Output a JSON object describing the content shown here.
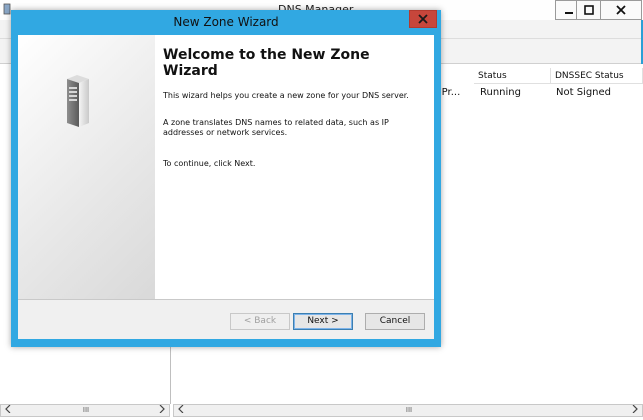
{
  "background_window": {
    "title": "DNS Manager",
    "columns": [
      "Status",
      "DNSSEC Status"
    ],
    "row": {
      "truncated_cell": "ed Pr...",
      "status": "Running",
      "dnssec_status": "Not Signed"
    },
    "scroll_thumb_label": "III"
  },
  "wizard": {
    "title": "New Zone Wizard",
    "heading": "Welcome to the New Zone Wizard",
    "para1": "This wizard helps you create a new zone for your DNS server.",
    "para2": "A zone translates DNS names to related data, such as IP addresses or network services.",
    "para3": "To continue, click Next.",
    "buttons": {
      "back": "< Back",
      "next": "Next >",
      "cancel": "Cancel"
    }
  },
  "colors": {
    "accent_frame": "#31a8e2",
    "close_button": "#c7463b"
  },
  "icons": [
    "server-icon",
    "minimize-icon",
    "maximize-icon",
    "close-icon",
    "arrow-left-icon",
    "arrow-right-icon"
  ]
}
